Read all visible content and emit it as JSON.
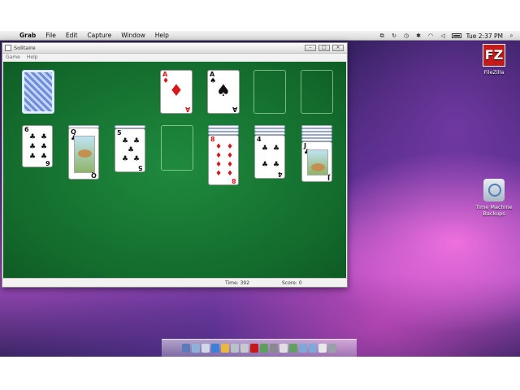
{
  "menubar": {
    "apple_icon": "apple-icon",
    "items": [
      "Grab",
      "File",
      "Edit",
      "Capture",
      "Window",
      "Help"
    ],
    "clock": "Tue 2:37 PM"
  },
  "window": {
    "title": "Solitaire",
    "menu": [
      "Game",
      "Help"
    ],
    "status_time": "Time: 392",
    "status_score": "Score: 0"
  },
  "cards": {
    "foundation_1": {
      "rank": "A",
      "suit": "♦"
    },
    "foundation_2": {
      "rank": "A",
      "suit": "♠"
    },
    "tableau_1": {
      "rank": "6",
      "suit": "♣"
    },
    "tableau_2": {
      "rank": "Q",
      "suit": "♣"
    },
    "tableau_3": {
      "rank": "5",
      "suit": "♣"
    },
    "tableau_5": {
      "rank": "8",
      "suit": "♦"
    },
    "tableau_6": {
      "rank": "4",
      "suit": "♣"
    },
    "tableau_7": {
      "rank": "J",
      "suit": "♣"
    }
  },
  "desktop_icons": {
    "filezilla": {
      "label": "FileZilla",
      "glyph": "FZ"
    },
    "time_machine": {
      "label": "Time Machine Backups"
    }
  },
  "colors": {
    "felt": "#136b2c",
    "filezilla": "#c51a1a"
  }
}
